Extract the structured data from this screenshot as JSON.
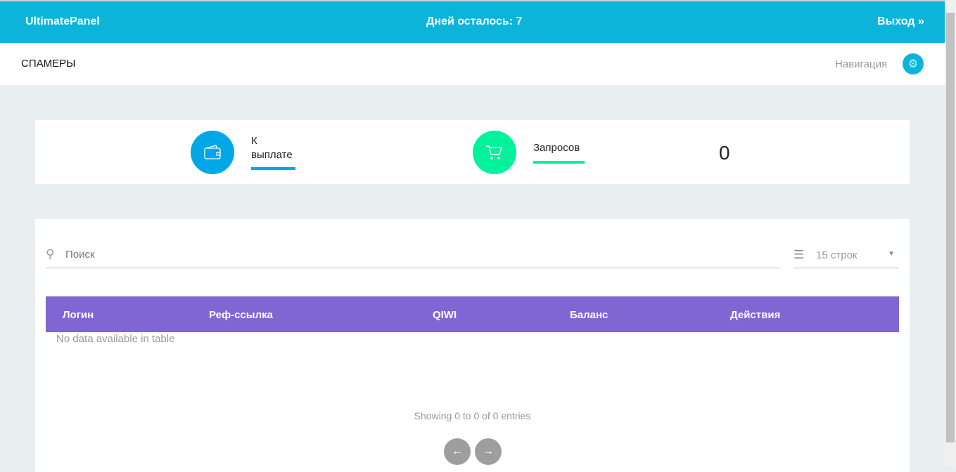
{
  "header": {
    "brand": "UltimatePanel",
    "days_left": "Дней осталось: 7",
    "logout": "Выход »"
  },
  "subheader": {
    "title": "СПАМЕРЫ",
    "nav": "Навигация"
  },
  "stats": [
    {
      "label": "К выплате",
      "value": ""
    },
    {
      "label": "Запросов",
      "value": "0"
    }
  ],
  "table": {
    "search_placeholder": "Поиск",
    "rows_select": "15 строк",
    "columns": [
      "Логин",
      "Реф-ссылка",
      "QIWI",
      "Баланс",
      "Действия"
    ],
    "empty": "No data available in table",
    "info": "Showing 0 to 0 of 0 entries",
    "prev": "←",
    "next": "→"
  }
}
